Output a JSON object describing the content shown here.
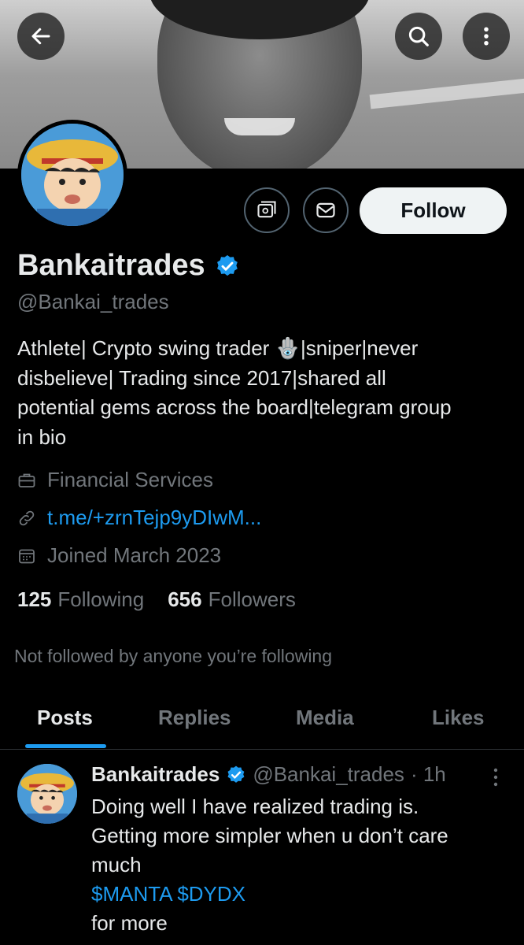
{
  "header": {
    "back_icon": "arrow-left-icon",
    "search_icon": "search-icon",
    "more_icon": "more-vertical-icon"
  },
  "actions": {
    "follow_label": "Follow",
    "wallet_icon": "tip-jar-icon",
    "message_icon": "mail-icon"
  },
  "profile": {
    "name": "Bankaitrades",
    "handle": "@Bankai_trades",
    "bio_lines": [
      "Athlete| Crypto swing trader 🪬|sniper|never",
      "disbelieve| Trading since 2017|shared all",
      "potential gems across the board|telegram group",
      "in bio"
    ],
    "category": "Financial Services",
    "link": "t.me/+zrnTejp9yDIwM...",
    "joined": "Joined March 2023",
    "following_count": "125",
    "following_label": "Following",
    "followers_count": "656",
    "followers_label": "Followers",
    "followed_by_note": "Not followed by anyone you’re following"
  },
  "tabs": [
    {
      "label": "Posts",
      "active": true
    },
    {
      "label": "Replies",
      "active": false
    },
    {
      "label": "Media",
      "active": false
    },
    {
      "label": "Likes",
      "active": false
    }
  ],
  "post": {
    "author": "Bankaitrades",
    "handle": "@Bankai_trades",
    "time": "· 1h",
    "lines": [
      "Doing well I have realized trading is.",
      "Getting more simpler when u don’t care",
      "much"
    ],
    "cashtags": "$MANTA $DYDX",
    "last_line": "for more"
  },
  "colors": {
    "accent": "#1d9bf0",
    "muted": "#71767b",
    "text": "#e7e9ea",
    "background": "#000000"
  }
}
